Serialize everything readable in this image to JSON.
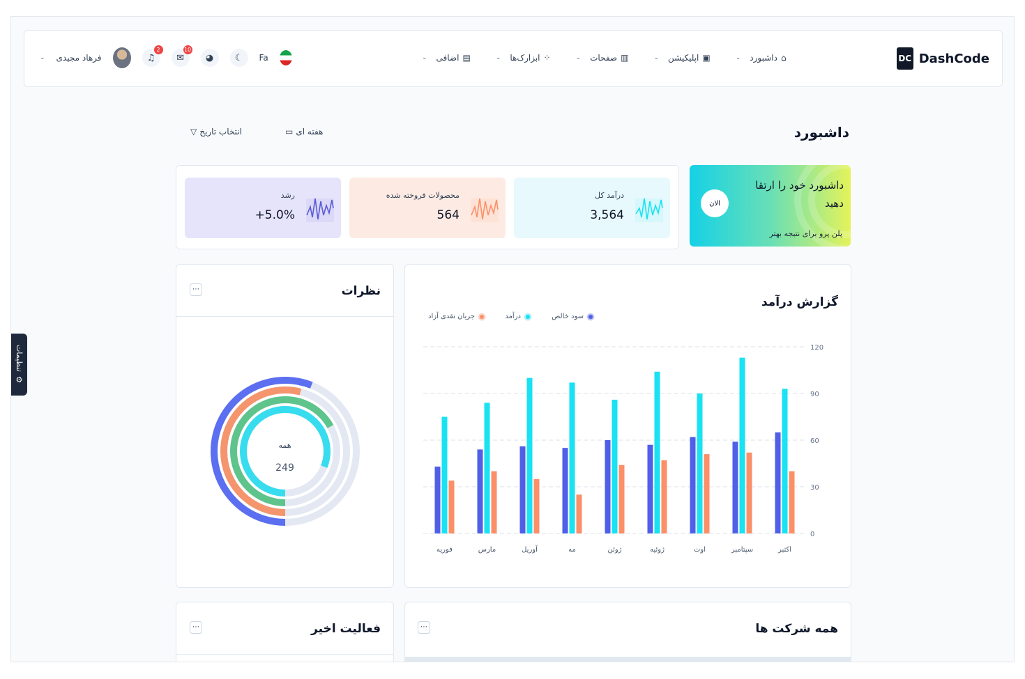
{
  "brand": {
    "name": "DashCode",
    "logo_letters": "DC"
  },
  "menu": [
    {
      "label": "داشبورد",
      "icon": "home-icon"
    },
    {
      "label": "اپلیکیشن",
      "icon": "chip-icon"
    },
    {
      "label": "صفحات",
      "icon": "columns-icon"
    },
    {
      "label": "ابزارک‌ها",
      "icon": "widgets-icon"
    },
    {
      "label": "اضافی",
      "icon": "layout-icon"
    }
  ],
  "toolbar": {
    "user_name": "فرهاد مجیدی",
    "language": "Fa",
    "notifications_count": "2",
    "messages_count": "10"
  },
  "page": {
    "title": "داشبورد",
    "week_filter": "هفته ای",
    "date_filter": "انتخاب تاریخ"
  },
  "promo": {
    "title": "داشبورد خود را ارتقا دهید",
    "subtitle": "پلن پرو برای نتیجه بهتر",
    "button": "الان"
  },
  "stats": [
    {
      "label": "درآمد کل",
      "value": "3,564",
      "color": "#22d3ee",
      "bg": "#e7f9fd"
    },
    {
      "label": "محصولات فروخته شده",
      "value": "564",
      "color": "#fb923c",
      "bg": "#fdebe3"
    },
    {
      "label": "رشد",
      "value": "+5.0%",
      "color": "#5b5bd6",
      "bg": "#e6e4fa"
    }
  ],
  "revenue": {
    "title": "گزارش درآمد"
  },
  "reviews": {
    "title": "نظرات",
    "center_label": "همه",
    "center_value": "249"
  },
  "activity": {
    "title": "فعالیت اخیر"
  },
  "companies": {
    "title": "همه شرکت ها"
  },
  "settings_tab": {
    "label": "تنظیمات"
  },
  "chart_data": {
    "type": "bar",
    "title": "گزارش درآمد",
    "categories": [
      "اکتبر",
      "سپتامبر",
      "اوت",
      "ژوئیه",
      "ژوئن",
      "مه",
      "آوریل",
      "مارس",
      "فوریه"
    ],
    "series": [
      {
        "name": "سود خالص",
        "color": "#4f5fe8",
        "values": [
          65,
          59,
          62,
          57,
          60,
          55,
          56,
          54,
          43
        ]
      },
      {
        "name": "درآمد",
        "color": "#19e2f2",
        "values": [
          93,
          113,
          90,
          104,
          86,
          97,
          100,
          84,
          75
        ]
      },
      {
        "name": "جریان نقدی آزاد",
        "color": "#fb8f68",
        "values": [
          40,
          52,
          51,
          47,
          44,
          25,
          35,
          40,
          34
        ]
      }
    ],
    "ylim": [
      0,
      120
    ],
    "yticks": [
      "0",
      "30",
      "60",
      "90",
      "120"
    ],
    "grid": true,
    "legend": "top-right"
  },
  "reviews_chart": {
    "type": "radial",
    "rings": [
      {
        "color": "#5b6ff0",
        "fraction": 0.56
      },
      {
        "color": "#f4956e",
        "fraction": 0.54
      },
      {
        "color": "#5ec48c",
        "fraction": 0.67
      },
      {
        "color": "#37dcee",
        "fraction": 0.81
      }
    ]
  }
}
